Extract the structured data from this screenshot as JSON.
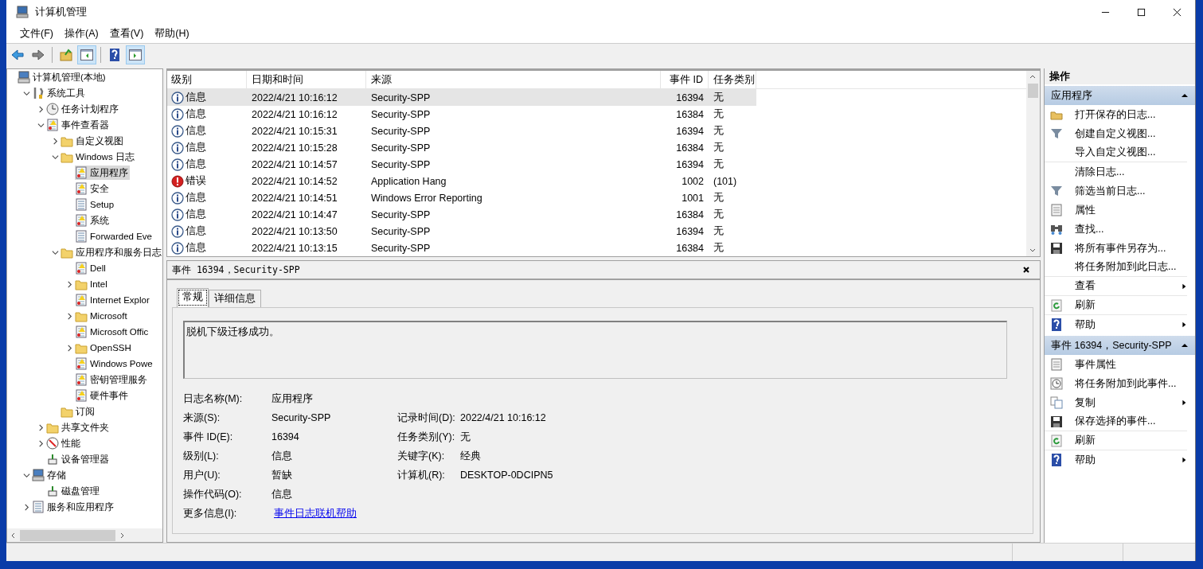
{
  "window": {
    "title": "计算机管理"
  },
  "menu": [
    "文件(F)",
    "操作(A)",
    "查看(V)",
    "帮助(H)"
  ],
  "toolbar": [
    {
      "kind": "back",
      "pressed": false
    },
    {
      "kind": "forward",
      "pressed": false
    },
    {
      "kind": "sep"
    },
    {
      "kind": "up",
      "pressed": false
    },
    {
      "kind": "tree",
      "pressed": true
    },
    {
      "kind": "sep"
    },
    {
      "kind": "help",
      "pressed": false
    },
    {
      "kind": "pane",
      "pressed": true
    }
  ],
  "tree": [
    {
      "label": "计算机管理(本地)",
      "kind": "computer",
      "selected": false,
      "children": [
        {
          "label": "系统工具",
          "kind": "tools",
          "expanded": true,
          "selected": false,
          "children": [
            {
              "label": "任务计划程序",
              "kind": "clock",
              "expanded": false,
              "selected": false
            },
            {
              "label": "事件查看器",
              "kind": "log",
              "expanded": true,
              "selected": false,
              "children": [
                {
                  "label": "自定义视图",
                  "kind": "folder",
                  "expanded": false,
                  "selected": false
                },
                {
                  "label": "Windows 日志",
                  "kind": "folder",
                  "expanded": true,
                  "selected": false,
                  "children": [
                    {
                      "label": "应用程序",
                      "kind": "log",
                      "selected": true
                    },
                    {
                      "label": "安全",
                      "kind": "log",
                      "selected": false
                    },
                    {
                      "label": "Setup",
                      "kind": "doc",
                      "selected": false
                    },
                    {
                      "label": "系统",
                      "kind": "log",
                      "selected": false
                    },
                    {
                      "label": "Forwarded Eve",
                      "kind": "doc",
                      "selected": false
                    }
                  ]
                },
                {
                  "label": "应用程序和服务日志",
                  "kind": "folder",
                  "expanded": true,
                  "selected": false,
                  "children": [
                    {
                      "label": "Dell",
                      "kind": "log",
                      "selected": false
                    },
                    {
                      "label": "Intel",
                      "kind": "folder",
                      "expanded": false,
                      "selected": false
                    },
                    {
                      "label": "Internet Explor",
                      "kind": "log",
                      "selected": false
                    },
                    {
                      "label": "Microsoft",
                      "kind": "folder",
                      "expanded": false,
                      "selected": false
                    },
                    {
                      "label": "Microsoft Offic",
                      "kind": "log",
                      "selected": false
                    },
                    {
                      "label": "OpenSSH",
                      "kind": "folder",
                      "expanded": false,
                      "selected": false
                    },
                    {
                      "label": "Windows Powe",
                      "kind": "log",
                      "selected": false
                    },
                    {
                      "label": "密钥管理服务",
                      "kind": "log",
                      "selected": false
                    },
                    {
                      "label": "硬件事件",
                      "kind": "log",
                      "selected": false
                    }
                  ]
                },
                {
                  "label": "订阅",
                  "kind": "folder",
                  "selected": false
                }
              ]
            },
            {
              "label": "共享文件夹",
              "kind": "folder",
              "expanded": false,
              "selected": false
            },
            {
              "label": "性能",
              "kind": "gauge",
              "expanded": false,
              "selected": false
            },
            {
              "label": "设备管理器",
              "kind": "device",
              "selected": false
            }
          ]
        },
        {
          "label": "存储",
          "kind": "computer",
          "expanded": true,
          "selected": false,
          "children": [
            {
              "label": "磁盘管理",
              "kind": "device",
              "selected": false
            }
          ]
        },
        {
          "label": "服务和应用程序",
          "kind": "doc",
          "expanded": false,
          "selected": false
        }
      ]
    }
  ],
  "events": {
    "columns": [
      "级别",
      "日期和时间",
      "来源",
      "事件 ID",
      "任务类别"
    ],
    "rows": [
      {
        "kind": "info",
        "level": "信息",
        "date": "2022/4/21 10:16:12",
        "source": "Security-SPP",
        "id": "16394",
        "task": "无",
        "selected": true
      },
      {
        "kind": "info",
        "level": "信息",
        "date": "2022/4/21 10:16:12",
        "source": "Security-SPP",
        "id": "16384",
        "task": "无",
        "selected": false
      },
      {
        "kind": "info",
        "level": "信息",
        "date": "2022/4/21 10:15:31",
        "source": "Security-SPP",
        "id": "16394",
        "task": "无",
        "selected": false
      },
      {
        "kind": "info",
        "level": "信息",
        "date": "2022/4/21 10:15:28",
        "source": "Security-SPP",
        "id": "16384",
        "task": "无",
        "selected": false
      },
      {
        "kind": "info",
        "level": "信息",
        "date": "2022/4/21 10:14:57",
        "source": "Security-SPP",
        "id": "16394",
        "task": "无",
        "selected": false
      },
      {
        "kind": "error",
        "level": "错误",
        "date": "2022/4/21 10:14:52",
        "source": "Application Hang",
        "id": "1002",
        "task": "(101)",
        "selected": false
      },
      {
        "kind": "info",
        "level": "信息",
        "date": "2022/4/21 10:14:51",
        "source": "Windows Error Reporting",
        "id": "1001",
        "task": "无",
        "selected": false
      },
      {
        "kind": "info",
        "level": "信息",
        "date": "2022/4/21 10:14:47",
        "source": "Security-SPP",
        "id": "16384",
        "task": "无",
        "selected": false
      },
      {
        "kind": "info",
        "level": "信息",
        "date": "2022/4/21 10:13:50",
        "source": "Security-SPP",
        "id": "16394",
        "task": "无",
        "selected": false
      },
      {
        "kind": "info",
        "level": "信息",
        "date": "2022/4/21 10:13:15",
        "source": "Security-SPP",
        "id": "16384",
        "task": "无",
        "selected": false
      }
    ]
  },
  "detail": {
    "title": "事件 16394，Security-SPP",
    "tabs": [
      {
        "label": "常规",
        "selected": true
      },
      {
        "label": "详细信息",
        "selected": false
      }
    ],
    "message": "脱机下级迁移成功。",
    "fields": [
      {
        "label": "日志名称(M):",
        "value": "应用程序"
      },
      {
        "label": "来源(S):",
        "value": "Security-SPP",
        "label2": "记录时间(D):",
        "value2": "2022/4/21 10:16:12"
      },
      {
        "label": "事件 ID(E):",
        "value": "16394",
        "label2": "任务类别(Y):",
        "value2": "无"
      },
      {
        "label": "级别(L):",
        "value": "信息",
        "label2": "关键字(K):",
        "value2": "经典"
      },
      {
        "label": "用户(U):",
        "value": "暂缺",
        "label2": "计算机(R):",
        "value2": "DESKTOP-0DCIPN5"
      },
      {
        "label": "操作代码(O):",
        "value": "信息"
      },
      {
        "label": "更多信息(I):",
        "value": "事件日志联机帮助",
        "kind": "link"
      }
    ]
  },
  "actions": {
    "title": "操作",
    "sections": [
      {
        "title": "应用程序",
        "items": [
          {
            "label": "打开保存的日志...",
            "kind": "folder",
            "submenu": false,
            "divider": false
          },
          {
            "label": "创建自定义视图...",
            "kind": "filter",
            "submenu": false,
            "divider": false
          },
          {
            "label": "导入自定义视图...",
            "kind": "none",
            "submenu": false,
            "divider": true
          },
          {
            "label": "清除日志...",
            "kind": "none",
            "submenu": false,
            "divider": false
          },
          {
            "label": "筛选当前日志...",
            "kind": "filter",
            "submenu": false,
            "divider": false
          },
          {
            "label": "属性",
            "kind": "props",
            "submenu": false,
            "divider": false
          },
          {
            "label": "查找...",
            "kind": "find",
            "submenu": false,
            "divider": false
          },
          {
            "label": "将所有事件另存为...",
            "kind": "save",
            "submenu": false,
            "divider": false
          },
          {
            "label": "将任务附加到此日志...",
            "kind": "none",
            "submenu": false,
            "divider": true
          },
          {
            "label": "查看",
            "kind": "none",
            "submenu": true,
            "divider": true
          },
          {
            "label": "刷新",
            "kind": "refresh",
            "submenu": false,
            "divider": true
          },
          {
            "label": "帮助",
            "kind": "help",
            "submenu": true,
            "divider": false
          }
        ]
      },
      {
        "title": "事件 16394，Security-SPP",
        "items": [
          {
            "label": "事件属性",
            "kind": "props",
            "submenu": false,
            "divider": false
          },
          {
            "label": "将任务附加到此事件...",
            "kind": "clock",
            "submenu": false,
            "divider": false
          },
          {
            "label": "复制",
            "kind": "copy",
            "submenu": true,
            "divider": false
          },
          {
            "label": "保存选择的事件...",
            "kind": "save",
            "submenu": false,
            "divider": true
          },
          {
            "label": "刷新",
            "kind": "refresh",
            "submenu": false,
            "divider": true
          },
          {
            "label": "帮助",
            "kind": "help",
            "submenu": true,
            "divider": false
          }
        ]
      }
    ]
  }
}
